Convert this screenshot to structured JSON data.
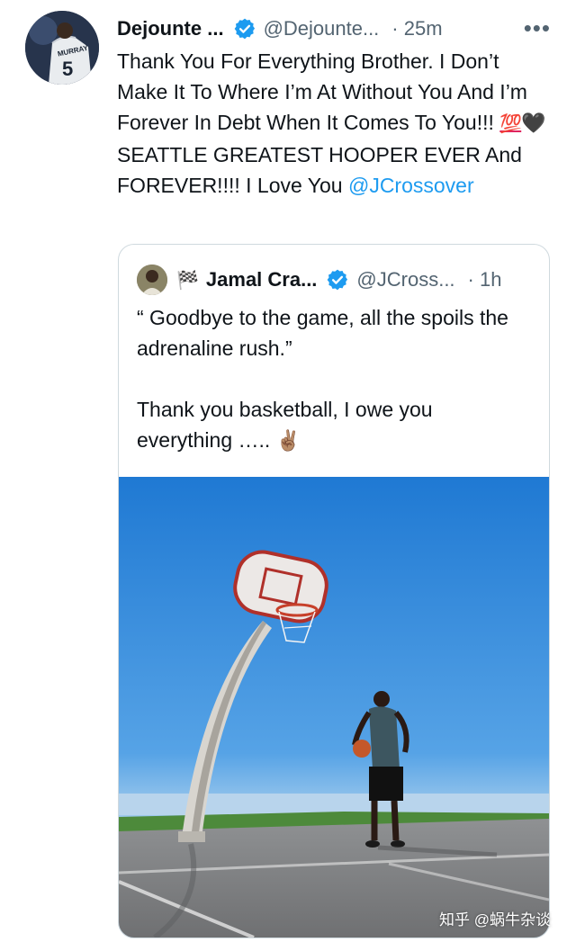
{
  "tweet": {
    "author_name": "Dejounte ...",
    "handle": "@Dejounte...",
    "time": "· 25m",
    "more_icon": "more-icon",
    "text_main": "Thank You For Everything Brother. I Don’t Make It To Where I’m At Without You And I’m Forever In Debt When It Comes To You!!! ",
    "emoji_100": "💯",
    "emoji_heart": "🖤",
    "text_after": " SEATTLE GREATEST HOOPER EVER And FOREVER!!!! I Love You ",
    "mention": "@JCrossover",
    "avatar_jersey_name": "MURRAY",
    "avatar_jersey_number": "5"
  },
  "quote": {
    "flag_icon": "🏁",
    "author_name": "Jamal Cra...",
    "handle": "@JCross...",
    "time": "· 1h",
    "text": "“ Goodbye to the game, all the spoils the adrenaline rush.”\n\nThank you basketball, I owe you everything …..",
    "emoji_peace": "✌🏽"
  },
  "colors": {
    "accent": "#1d9bf0",
    "secondary_text": "#536471",
    "border": "#cfd9de"
  },
  "watermark": "知乎 @蜗牛杂谈"
}
